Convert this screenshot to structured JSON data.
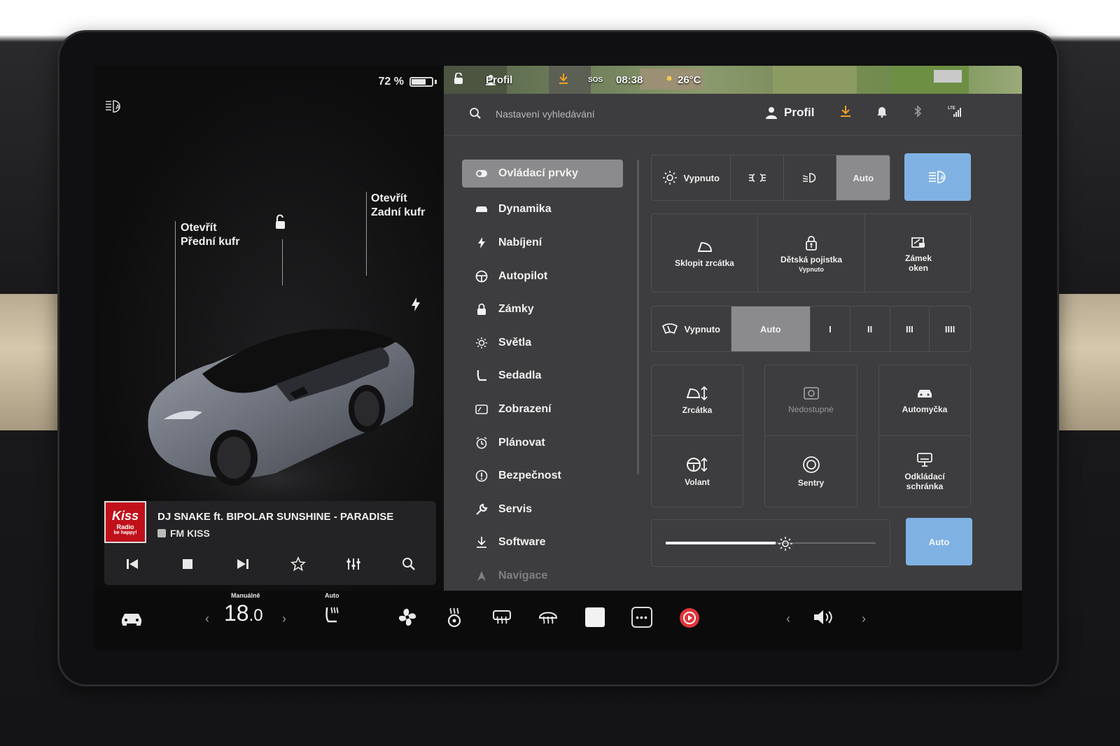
{
  "status": {
    "battery_pct_label": "72 %",
    "battery_level": 0.72
  },
  "map": {
    "profile": "Profil",
    "sos": "SOS",
    "time": "08:38",
    "temperature": "26°C"
  },
  "car": {
    "front_trunk": {
      "line1": "Otevřít",
      "line2": "Přední kufr"
    },
    "rear_trunk": {
      "line1": "Otevřít",
      "line2": "Zadní kufr"
    }
  },
  "media": {
    "logo_text": "Kiss",
    "logo_sub": "Radio",
    "logo_tag": "be happy!",
    "title": "DJ SNAKE ft. BIPOLAR SUNSHINE - PARADISE",
    "station": "FM KISS"
  },
  "search": {
    "placeholder": "Nastavení vyhledávání"
  },
  "header": {
    "profile": "Profil"
  },
  "menu": [
    {
      "label": "Ovládací prvky",
      "icon": "toggle-icon",
      "active": true
    },
    {
      "label": "Dynamika",
      "icon": "car-icon"
    },
    {
      "label": "Nabíjení",
      "icon": "bolt-icon"
    },
    {
      "label": "Autopilot",
      "icon": "steering-wheel-icon"
    },
    {
      "label": "Zámky",
      "icon": "lock-icon"
    },
    {
      "label": "Světla",
      "icon": "sun-icon"
    },
    {
      "label": "Sedadla",
      "icon": "seat-icon"
    },
    {
      "label": "Zobrazení",
      "icon": "display-icon"
    },
    {
      "label": "Plánovat",
      "icon": "alarm-clock-icon"
    },
    {
      "label": "Bezpečnost",
      "icon": "info-circle-icon"
    },
    {
      "label": "Servis",
      "icon": "wrench-icon"
    },
    {
      "label": "Software",
      "icon": "download-icon"
    },
    {
      "label": "Navigace",
      "icon": "navigation-icon"
    }
  ],
  "lights": {
    "off_label": "Vypnuto",
    "auto_label": "Auto",
    "selected": "Auto"
  },
  "quick": {
    "fold_mirrors": "Sklopit zrcátka",
    "child_lock": "Dětská pojistka",
    "child_lock_state": "Vypnuto",
    "window_lock": "Zámek oken",
    "window_lock_l1": "Zámek",
    "window_lock_l2": "oken"
  },
  "wipers": {
    "off_label": "Vypnuto",
    "auto_label": "Auto",
    "speeds": [
      "I",
      "II",
      "III",
      "IIII"
    ],
    "selected": "Auto"
  },
  "tiles": {
    "mirrors": "Zrcátka",
    "unavailable": "Nedostupné",
    "car_wash": "Automyčka",
    "steering": "Volant",
    "sentry": "Sentry",
    "glovebox_l1": "Odkládací",
    "glovebox_l2": "schránka"
  },
  "brightness": {
    "level": 0.57,
    "auto_label": "Auto"
  },
  "climate": {
    "mode_label": "Manuálně",
    "temp_int": "18",
    "temp_dec": ".0",
    "seat_heat_label": "Auto"
  },
  "colors": {
    "accent_blue": "#7fb2e3",
    "record_red": "#e0353b",
    "panel": "#3d3d3f"
  }
}
